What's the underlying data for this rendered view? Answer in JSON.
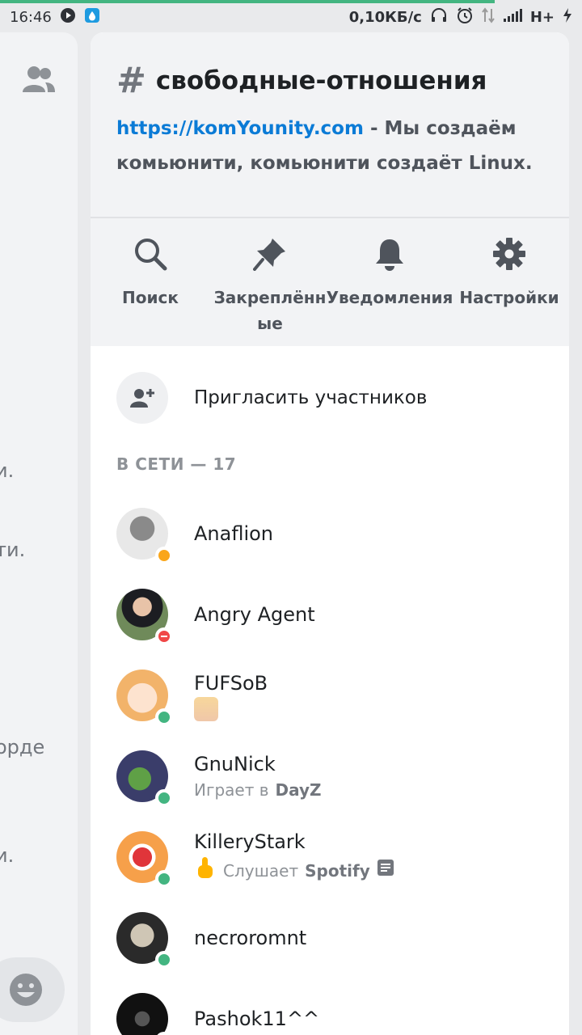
{
  "status_bar": {
    "time": "16:46",
    "network_speed": "0,10КБ/с",
    "network_type": "H+"
  },
  "left_peek": {
    "lines": [
      "и.",
      "ти.",
      "орде",
      "и."
    ]
  },
  "channel": {
    "hash": "#",
    "name": "свободные-отношения",
    "topic_link": "https://komYounity.com",
    "topic_text": " - Мы создаём комьюнити, комьюнити создаёт Linux."
  },
  "actions": [
    {
      "label": "Поиск",
      "icon": "search-icon"
    },
    {
      "label": "Закреплённые",
      "icon": "pin-icon"
    },
    {
      "label": "Уведомления",
      "icon": "bell-icon"
    },
    {
      "label": "Настройки",
      "icon": "gear-icon"
    }
  ],
  "invite": {
    "label": "Пригласить участников",
    "icon": "add-user-icon"
  },
  "online_header": "В СЕТИ — 17",
  "members": [
    {
      "name": "Anaflion",
      "status": "idle",
      "sub_prefix": "",
      "sub_bold": "",
      "avatar_color": "#d9d9d9"
    },
    {
      "name": "Angry Agent",
      "status": "dnd",
      "sub_prefix": "",
      "sub_bold": "",
      "avatar_color": "#6a7a5a"
    },
    {
      "name": "FUFSoB",
      "status": "online",
      "sub_prefix": "",
      "sub_bold": "",
      "avatar_color": "#f3c9a4"
    },
    {
      "name": "GnuNick",
      "status": "online",
      "sub_prefix": "Играет в ",
      "sub_bold": "DayZ",
      "avatar_color": "#4a4c7a"
    },
    {
      "name": "KilleryStark",
      "status": "online",
      "sub_prefix": "Слушает ",
      "sub_bold": "Spotify",
      "avatar_color": "#f59a3c"
    },
    {
      "name": "necroromnt",
      "status": "online",
      "sub_prefix": "",
      "sub_bold": "",
      "avatar_color": "#3a3a3a"
    },
    {
      "name": "Pashok11^^",
      "status": "online",
      "sub_prefix": "",
      "sub_bold": "",
      "avatar_color": "#1a1a1a"
    }
  ]
}
